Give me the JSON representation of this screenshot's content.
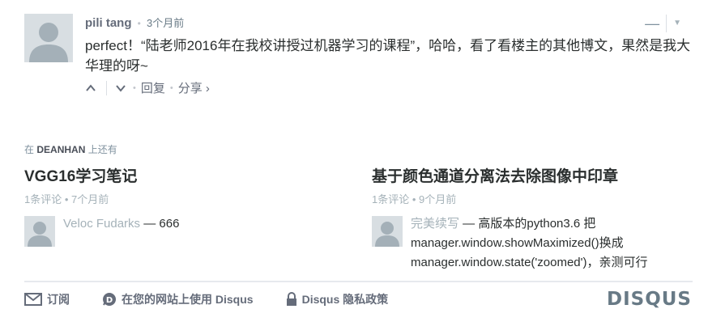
{
  "comment": {
    "author": "pili tang",
    "time": "3个月前",
    "body": "perfect！“陆老师2016年在我校讲授过机器学习的课程”，哈哈，看了看楼主的其他博文，果然是我大华理的呀~",
    "reply_label": "回复",
    "share_label": "分享 ›",
    "minus_glyph": "—",
    "menu_glyph": "▼"
  },
  "more_on": {
    "prefix": "在",
    "site": "DEANHAN",
    "suffix": "上还有",
    "items": [
      {
        "title": "VGG16学习笔记",
        "meta": "1条评论 • 7个月前",
        "author": "Veloc Fudarks",
        "text": " — 666"
      },
      {
        "title": "基于颜色通道分离法去除图像中印章",
        "meta": "1条评论 • 9个月前",
        "author": "完美续写",
        "text": " — 高版本的python3.6 把 manager.window.showMaximized()换成 manager.window.state('zoomed')，亲测可行"
      }
    ]
  },
  "footer": {
    "subscribe": "订阅",
    "add_disqus": "在您的网站上使用 Disqus",
    "privacy": "Disqus 隐私政策",
    "brand": "DISQUS"
  }
}
